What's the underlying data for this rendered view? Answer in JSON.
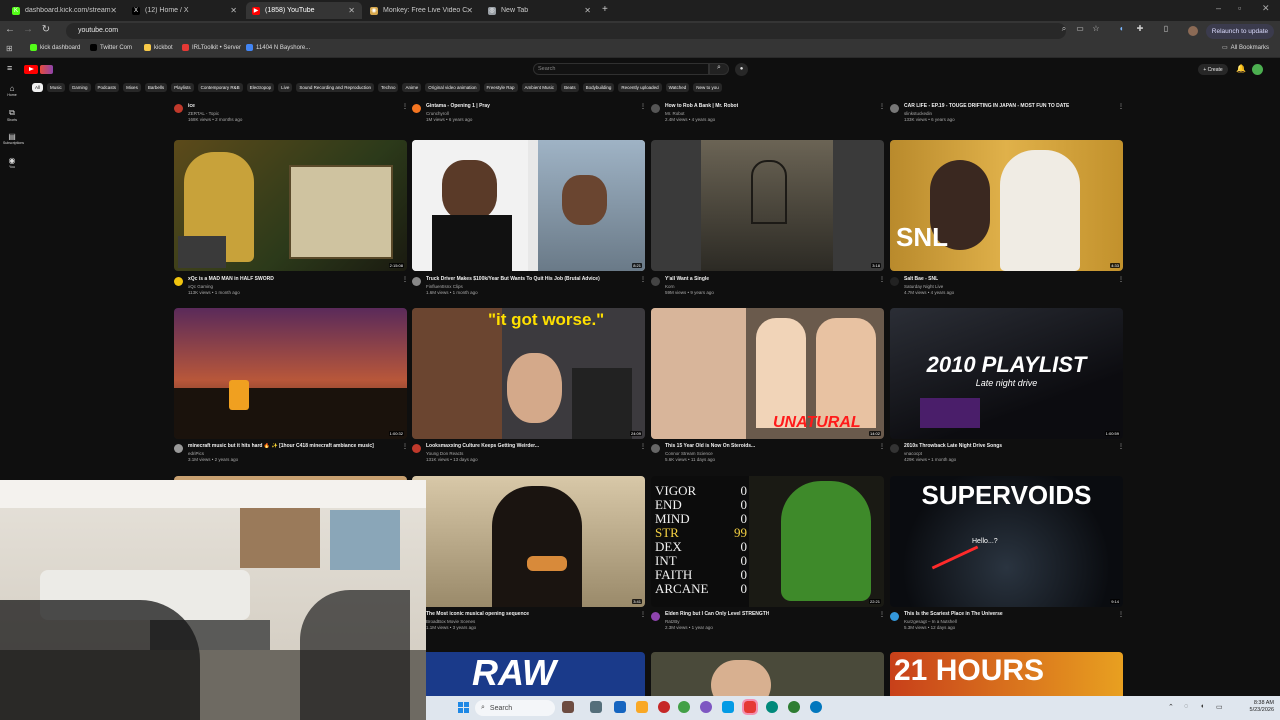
{
  "browser": {
    "tabs": [
      {
        "title": "dashboard.kick.com/stream",
        "color": "#53fc18",
        "glyph": "K"
      },
      {
        "title": "(12) Home / X",
        "color": "#000000",
        "glyph": "X"
      },
      {
        "title": "(1858) YouTube",
        "color": "#ff0000",
        "glyph": "▶",
        "active": true
      },
      {
        "title": "Monkey: Free Live Video C",
        "color": "#d8a84d",
        "glyph": "◉"
      },
      {
        "title": "New Tab",
        "color": "#9aa0a6",
        "glyph": "◎"
      }
    ],
    "new_tab_icon": "plus-icon",
    "url": "youtube.com",
    "relaunch_label": "Relaunch to update",
    "all_bookmarks_label": "All Bookmarks",
    "bookmarks": [
      {
        "label": "kick dashboard",
        "color": "#53fc18"
      },
      {
        "label": "Twitter Com",
        "color": "#000000"
      },
      {
        "label": "kickbot",
        "color": "#f7c948"
      },
      {
        "label": "IRLToolkit • Server",
        "color": "#e53935"
      },
      {
        "label": "11404 N Bayshore...",
        "color": "#4285f4"
      }
    ]
  },
  "youtube": {
    "search_placeholder": "Search",
    "create_label": "+ Create",
    "chips": [
      "All",
      "Music",
      "Gaming",
      "Podcasts",
      "Mixes",
      "Barbells",
      "Playlists",
      "Contemporary R&B",
      "Electropop",
      "Live",
      "Sound Recording and Reproduction",
      "Techno",
      "Anime",
      "Original video animation",
      "Freestyle Rap",
      "Ambient Music",
      "Beats",
      "Bodybuilding",
      "Recently uploaded",
      "Watched",
      "New to you"
    ],
    "guide": [
      {
        "label": "Home",
        "icon": "home-icon"
      },
      {
        "label": "Shorts",
        "icon": "shorts-icon"
      },
      {
        "label": "Subscriptions",
        "icon": "subscriptions-icon"
      },
      {
        "label": "You",
        "icon": "you-icon"
      }
    ],
    "rows": [
      [
        {
          "title": "ice",
          "channel": "ZERTAL - Topic",
          "meta": "168K views • 2 months ago",
          "avatar": "#c0392b"
        },
        {
          "title": "Gintama - Opening 1 | Pray",
          "channel": "Crunchyroll",
          "meta": "1M views • 6 years ago",
          "avatar": "#f47521"
        },
        {
          "title": "How to Rob A Bank | Mr. Robot",
          "channel": "Mr. Robot",
          "meta": "2.4M views • 4 years ago",
          "avatar": "#555555"
        },
        {
          "title": "CAR LIFE - EP.19 - TOUGE DRIFTING IN JAPAN - MOST FUN TO DATE",
          "channel": "slinkstuckedin",
          "meta": "133K views • 6 years ago",
          "avatar": "#777777"
        }
      ],
      [
        {
          "title": "xQc is a MAD MAN in HALF SWORD",
          "channel": "xQc Gaming",
          "meta": "113K views • 1 month ago",
          "avatar": "#f1c40f",
          "duration": "2:15:08"
        },
        {
          "title": "Truck Driver Makes $100k/Year But Wants To Quit His Job (Brutal Advice)",
          "channel": "FinfluentIsnx Clips",
          "meta": "1.6M views • 1 month ago",
          "avatar": "#888888",
          "duration": "8:21"
        },
        {
          "title": "Y'all Want a Single",
          "channel": "Korn",
          "meta": "59M views • 9 years ago",
          "avatar": "#444444",
          "duration": "3:18"
        },
        {
          "title": "Salt Bae - SNL",
          "channel": "Saturday Night Live",
          "meta": "4.7M views • 4 years ago",
          "avatar": "#222222",
          "duration": "4:33"
        }
      ],
      [
        {
          "title": "minecraft music but it hits hard 🔥 ✨ [1hour C418 minecraft ambiance music]",
          "channel": "edriPics",
          "meta": "3.1M views • 2 years ago",
          "avatar": "#999999",
          "duration": "1:00:32"
        },
        {
          "title": "Looksmaxxing Culture Keeps Getting Weirder...",
          "channel": "Young Don Reacts",
          "meta": "131K views • 13 days ago",
          "avatar": "#c0392b",
          "duration": "24:09"
        },
        {
          "title": "This 15 Year Old is Now On Steroids...",
          "channel": "Connor Stream Science",
          "meta": "5.6K views • 11 days ago",
          "avatar": "#666666",
          "duration": "14:02"
        },
        {
          "title": "2010s Throwback Late Night Drive Songs",
          "channel": "vnacocpt",
          "meta": "429K views • 1 month ago",
          "avatar": "#333333",
          "duration": "1:00:59"
        }
      ],
      [
        {
          "title": "The Most iconic musical opening sequence",
          "channel": "BroadBox Movie Scenes",
          "meta": "1.1M views • 3 years ago",
          "avatar": "#e67e22",
          "duration": "3:41"
        },
        {
          "title": "Elden Ring but I Can Only Level STRENGTH",
          "channel": "RatzBy",
          "meta": "2.3M views • 1 year ago",
          "avatar": "#8e44ad",
          "duration": "22:21"
        },
        {
          "title": "This Is the Scariest Place in The Universe",
          "channel": "Kurzgesagt – In a Nutshell",
          "meta": "5.3M views • 12 days ago",
          "avatar": "#3498db",
          "duration": "9:14"
        }
      ]
    ],
    "thumb_texts": {
      "worse": "\"it got worse.\"",
      "unatural": "UNATURAL",
      "snl": "SNL",
      "playlist_title": "2010 PLAYLIST",
      "playlist_sub": "Late night drive",
      "supervoids": "SUPERVOIDS",
      "hello": "Hello...?",
      "hours": "21 HOURS",
      "raw": "RAW",
      "elden_stats": [
        [
          "VIGOR",
          "0"
        ],
        [
          "END",
          "0"
        ],
        [
          "MIND",
          "0"
        ],
        [
          "STR",
          "99"
        ],
        [
          "DEX",
          "0"
        ],
        [
          "INT",
          "0"
        ],
        [
          "FAITH",
          "0"
        ],
        [
          "ARCANE",
          "0"
        ]
      ]
    }
  },
  "taskbar": {
    "search_label": "Search",
    "time": "8:38 AM",
    "date": "5/23/2026"
  }
}
